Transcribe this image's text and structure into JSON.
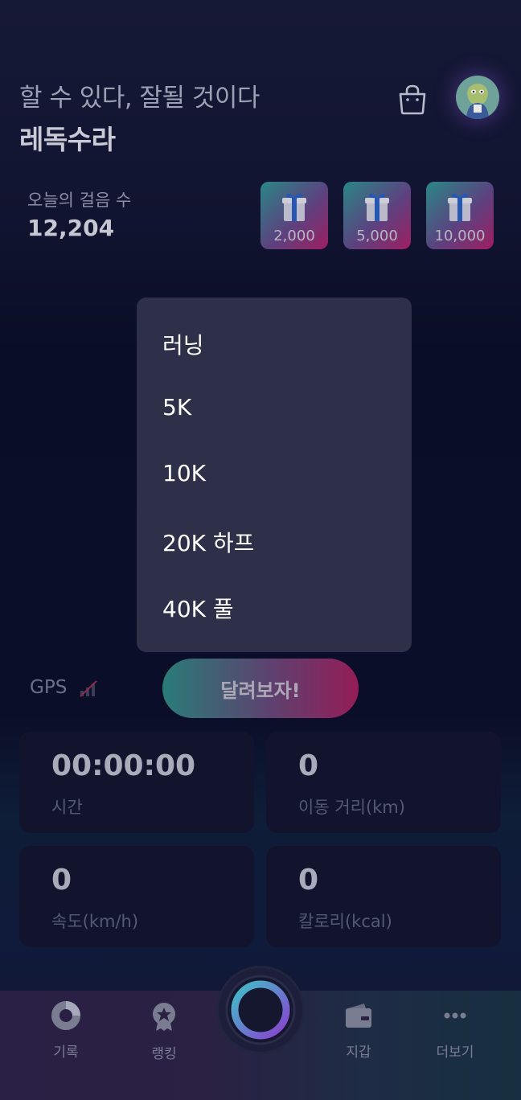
{
  "header": {
    "motto": "할 수 있다, 잘될 것이다",
    "username": "레독수라",
    "steps_label": "오늘의 걸음 수",
    "steps_value": "12,204"
  },
  "gifts": [
    {
      "amount": "2,000"
    },
    {
      "amount": "5,000"
    },
    {
      "amount": "10,000"
    }
  ],
  "menu": {
    "items": [
      "러닝",
      "5K",
      "10K",
      "20K 하프",
      "40K 풀"
    ]
  },
  "gps": {
    "label": "GPS"
  },
  "run_button": {
    "label": "달려보자!"
  },
  "stats": [
    {
      "value": "00:00:00",
      "label": "시간"
    },
    {
      "value": "0",
      "label": "이동 거리(km)"
    },
    {
      "value": "0",
      "label": "속도(km/h)"
    },
    {
      "value": "0",
      "label": "칼로리(kcal)"
    }
  ],
  "nav": {
    "records": "기록",
    "ranking": "랭킹",
    "wallet": "지갑",
    "more": "더보기"
  },
  "colors": {
    "accent_teal": "#2f8f86",
    "accent_magenta": "#ad1f5f",
    "menu_bg": "#2e3049",
    "card_bg": "#12142e"
  }
}
